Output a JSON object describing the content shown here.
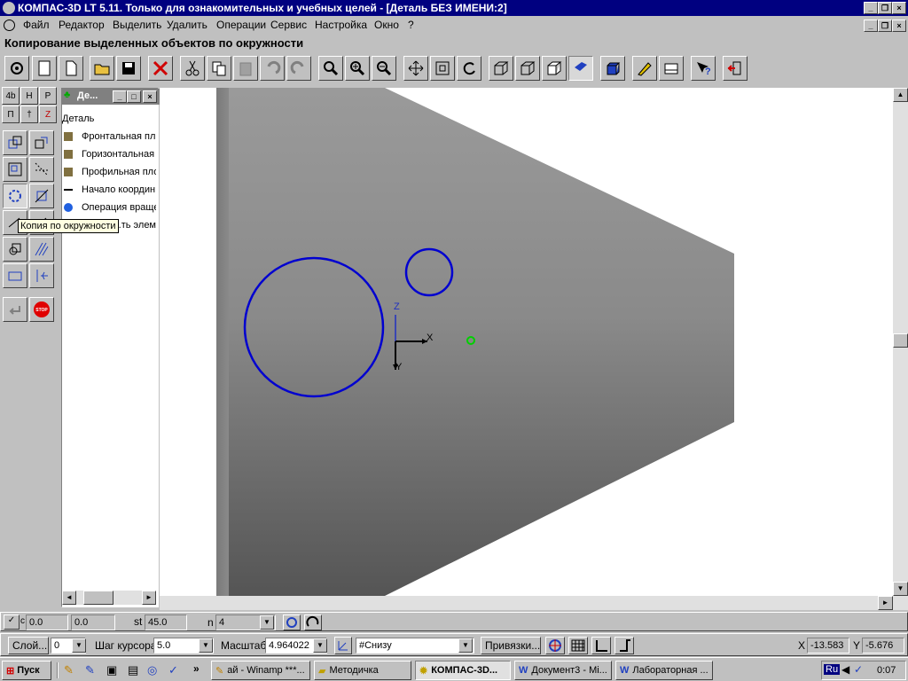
{
  "window": {
    "title": "КОМПАС-3D LT 5.11. Только для ознакомительных и учебных целей - [Деталь БЕЗ ИМЕНИ:2]"
  },
  "menu": [
    "Файл",
    "Редактор",
    "Выделить",
    "Удалить",
    "Операции",
    "Сервис",
    "Настройка",
    "Окно",
    "?"
  ],
  "command_title": "Копирование выделенных объектов по окружности",
  "toolbar_icons": [
    "new-view-icon",
    "new-document-icon",
    "new-blank-icon",
    "open-icon",
    "save-icon",
    "delete-icon",
    "cut-icon",
    "copy-icon",
    "paste-icon",
    "undo-icon",
    "redo-icon",
    "zoom-icon",
    "zoom-in-icon",
    "zoom-out-icon",
    "pan-icon",
    "zoom-fit-icon",
    "rotate-icon",
    "wireframe-icon",
    "hidden-lines-icon",
    "no-hidden-icon",
    "shaded-icon",
    "perspective-icon",
    "sketch-icon",
    "properties-icon",
    "help-icon",
    "exit-icon"
  ],
  "left_tabs": [
    "4b",
    "H",
    "P",
    "П",
    "†",
    "Z"
  ],
  "tree": {
    "header": "Де...",
    "root": "Деталь",
    "items": [
      "Фронтальная пл",
      "Горизонтальная",
      "Профильная пло",
      "Начало координ",
      "Операция враще",
      "...ть элем"
    ]
  },
  "tooltip": "Копия по окружности",
  "axes": {
    "z": "Z",
    "x": "X",
    "y": "Y"
  },
  "params": {
    "c_label": "c",
    "x_value": "0.0",
    "y_value": "0.0",
    "st_label": "st",
    "st_value": "45.0",
    "n_label": "n",
    "n_value": "4"
  },
  "status": {
    "layer_button": "Слой...",
    "layer_value": "0",
    "cursor_step_label": "Шаг курсора",
    "cursor_step_value": "5.0",
    "scale_label": "Масштаб",
    "scale_value": "4.964022",
    "view_value": "#Снизу",
    "snap_button": "Привязки...",
    "x_label": "X",
    "x_value": "-13.583",
    "y_label": "Y",
    "y_value": "-5.676"
  },
  "taskbar": {
    "start": "Пуск",
    "tasks": [
      "ай - Winamp ***...",
      "Методичка",
      "КОМПАС-3D...",
      "Документ3 - Mi...",
      "Лабораторная ..."
    ],
    "lang": "Ru",
    "clock": "0:07"
  }
}
